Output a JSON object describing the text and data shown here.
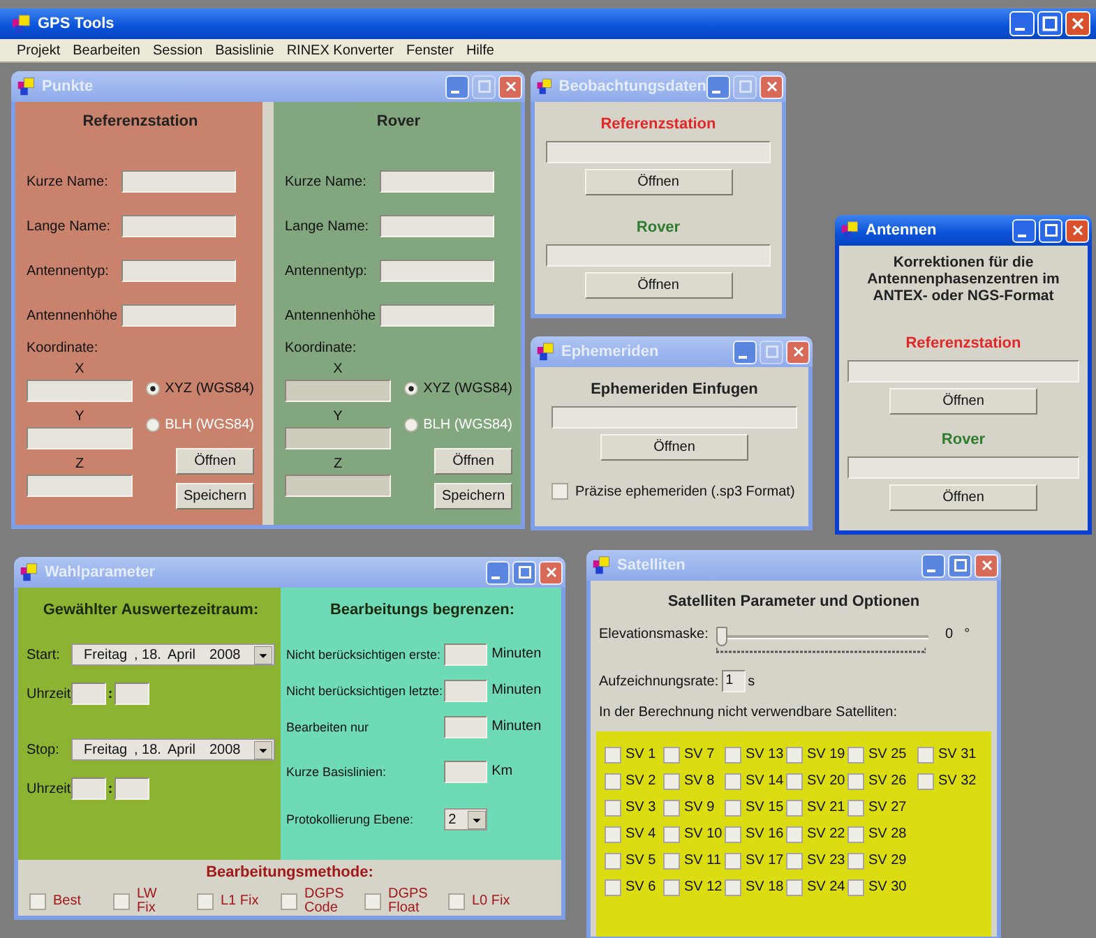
{
  "app": {
    "title": "GPS Tools"
  },
  "menu": [
    "Projekt",
    "Bearbeiten",
    "Session",
    "Basislinie",
    "RINEX Konverter",
    "Fenster",
    "Hilfe"
  ],
  "windows": [
    {
      "kind": "points",
      "title": "Punkte",
      "active": false,
      "maximize_enabled": false,
      "panels": [
        {
          "heading": "Referenzstation",
          "color": "#c9826c",
          "fields": [
            "Kurze Name:",
            "Lange Name:",
            "Antennentyp:",
            "Antennenhöhe"
          ],
          "coord_label": "Koordinate:",
          "axes": [
            "X",
            "Y",
            "Z"
          ],
          "options": [
            {
              "label": "XYZ (WGS84)",
              "selected": true,
              "disabled": false
            },
            {
              "label": "BLH (WGS84)",
              "selected": false,
              "disabled": true
            }
          ],
          "open_button": "Öffnen",
          "save_button": "Speichern"
        },
        {
          "heading": "Rover",
          "color": "#82a67e",
          "fields": [
            "Kurze Name:",
            "Lange Name:",
            "Antennentyp:",
            "Antennenhöhe"
          ],
          "coord_label": "Koordinate:",
          "axes": [
            "X",
            "Y",
            "Z"
          ],
          "options": [
            {
              "label": "XYZ (WGS84)",
              "selected": true,
              "disabled": false
            },
            {
              "label": "BLH (WGS84)",
              "selected": false,
              "disabled": true
            }
          ],
          "open_button": "Öffnen",
          "save_button": "Speichern"
        }
      ]
    },
    {
      "kind": "files",
      "title": "Beobachtungsdaten",
      "active": false,
      "maximize_enabled": false,
      "sections": [
        {
          "heading": "Referenzstation",
          "color": "#e02828",
          "button": "Öffnen"
        },
        {
          "heading": "Rover",
          "color": "#2e7d2e",
          "button": "Öffnen"
        }
      ]
    },
    {
      "kind": "ephemeris",
      "title": "Ephemeriden",
      "active": false,
      "maximize_enabled": false,
      "heading": "Ephemeriden Einfugen",
      "button": "Öffnen",
      "checkbox": {
        "label": "Präzise ephemeriden (.sp3 Format)",
        "checked": false
      }
    },
    {
      "kind": "antennas",
      "title": "Antennen",
      "active": true,
      "maximize_enabled": true,
      "intro": "Korrektionen für die Antennenphasenzentren im ANTEX- oder NGS-Format",
      "sections": [
        {
          "heading": "Referenzstation",
          "color": "#e02828",
          "button": "Öffnen"
        },
        {
          "heading": "Rover",
          "color": "#2e7d2e",
          "button": "Öffnen"
        }
      ]
    },
    {
      "kind": "parameters",
      "title": "Wahlparameter",
      "active": false,
      "maximize_enabled": true,
      "period": {
        "heading": "Gewählter Auswertezeitraum:",
        "rows": [
          {
            "label": "Start:",
            "weekday": "Freitag",
            "day": ", 18.",
            "month": "April",
            "year": "2008",
            "time_label": "Uhrzeit:",
            "separator": ":"
          },
          {
            "label": "Stop:",
            "weekday": "Freitag",
            "day": ", 18.",
            "month": "April",
            "year": "2008",
            "time_label": "Uhrzeit:",
            "separator": ":"
          }
        ]
      },
      "limits": {
        "heading": "Bearbeitungs begrenzen:",
        "rows": [
          {
            "kind": "field",
            "label": "Nicht berücksichtigen erste:",
            "unit": "Minuten"
          },
          {
            "kind": "field",
            "label": "Nicht berücksichtigen letzte:",
            "unit": "Minuten"
          },
          {
            "kind": "field",
            "label": "Bearbeiten nur",
            "unit": "Minuten"
          },
          {
            "kind": "field",
            "label": "Kurze Basislinien:",
            "unit": "Km"
          },
          {
            "kind": "dropdown",
            "label": "Protokollierung Ebene:",
            "value": "2"
          }
        ]
      },
      "method": {
        "heading": "Bearbeitungsmethode:",
        "options": [
          {
            "label": "Best",
            "checked": false
          },
          {
            "label": "LW Fix",
            "checked": false
          },
          {
            "label": "L1 Fix",
            "checked": false
          },
          {
            "label": "DGPS Code",
            "checked": false
          },
          {
            "label": "DGPS Float",
            "checked": false
          },
          {
            "label": "L0 Fix",
            "checked": false
          }
        ]
      }
    },
    {
      "kind": "satellites",
      "title": "Satelliten",
      "active": false,
      "maximize_enabled": true,
      "heading": "Satelliten Parameter und Optionen",
      "slider": {
        "label": "Elevationsmaske:",
        "level": 0,
        "reading": "0",
        "unit": "°"
      },
      "rate": {
        "label": "Aufzeichnungsrate:",
        "value": "1",
        "unit": "s"
      },
      "list_heading": "In der Berechnung nicht verwendbare Satelliten:",
      "satellites": [
        {
          "label": "SV 1",
          "checked": false
        },
        {
          "label": "SV 2",
          "checked": false
        },
        {
          "label": "SV 3",
          "checked": false
        },
        {
          "label": "SV 4",
          "checked": false
        },
        {
          "label": "SV 5",
          "checked": false
        },
        {
          "label": "SV 6",
          "checked": false
        },
        {
          "label": "SV 7",
          "checked": false
        },
        {
          "label": "SV 8",
          "checked": false
        },
        {
          "label": "SV 9",
          "checked": false
        },
        {
          "label": "SV 10",
          "checked": false
        },
        {
          "label": "SV 11",
          "checked": false
        },
        {
          "label": "SV 12",
          "checked": false
        },
        {
          "label": "SV 13",
          "checked": false
        },
        {
          "label": "SV 14",
          "checked": false
        },
        {
          "label": "SV 15",
          "checked": false
        },
        {
          "label": "SV 16",
          "checked": false
        },
        {
          "label": "SV 17",
          "checked": false
        },
        {
          "label": "SV 18",
          "checked": false
        },
        {
          "label": "SV 19",
          "checked": false
        },
        {
          "label": "SV 20",
          "checked": false
        },
        {
          "label": "SV 21",
          "checked": false
        },
        {
          "label": "SV 22",
          "checked": false
        },
        {
          "label": "SV 23",
          "checked": false
        },
        {
          "label": "SV 24",
          "checked": false
        },
        {
          "label": "SV 25",
          "checked": false
        },
        {
          "label": "SV 26",
          "checked": false
        },
        {
          "label": "SV 27",
          "checked": false
        },
        {
          "label": "SV 28",
          "checked": false
        },
        {
          "label": "SV 29",
          "checked": false
        },
        {
          "label": "SV 30",
          "checked": false
        },
        {
          "label": "SV 31",
          "checked": false
        },
        {
          "label": "SV 32",
          "checked": false
        }
      ]
    }
  ]
}
